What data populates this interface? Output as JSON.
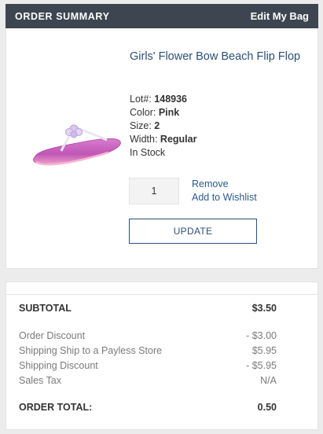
{
  "header": {
    "title": "ORDER SUMMARY",
    "edit_label": "Edit My Bag"
  },
  "product": {
    "name": "Girls' Flower Bow Beach Flip Flop",
    "lot_label": "Lot#:",
    "lot": "148936",
    "color_label": "Color:",
    "color": "Pink",
    "size_label": "Size:",
    "size": "2",
    "width_label": "Width:",
    "width": "Regular",
    "stock": "In Stock",
    "quantity": "1",
    "remove_label": "Remove",
    "wishlist_label": "Add to Wishlist",
    "update_label": "UPDATE"
  },
  "totals": {
    "subtotal_label": "SUBTOTAL",
    "subtotal": "$3.50",
    "lines": [
      {
        "label": "Order Discount",
        "value": "- $3.00"
      },
      {
        "label": "Shipping Ship to a Payless Store",
        "value": "$5.95"
      },
      {
        "label": "Shipping Discount",
        "value": "- $5.95"
      },
      {
        "label": "Sales Tax",
        "value": "N/A"
      }
    ],
    "order_total_label": "ORDER TOTAL:",
    "order_total": "0.50"
  },
  "colors": {
    "header_bg": "#3d4650",
    "link": "#2a5a8c",
    "sandal_pink": "#c255b8"
  }
}
